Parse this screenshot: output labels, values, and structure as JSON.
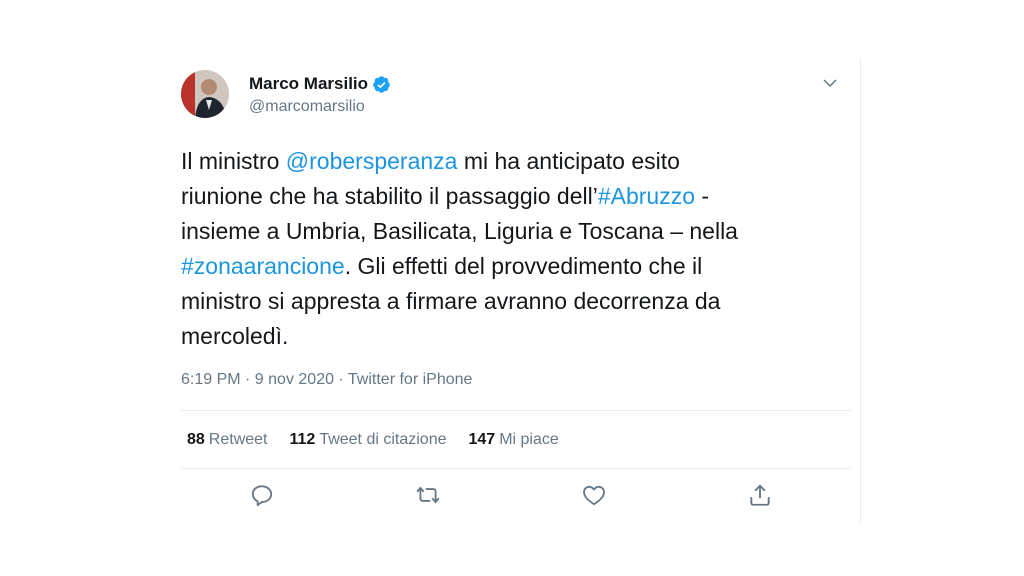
{
  "author": {
    "name": "Marco Marsilio",
    "handle": "@marcomarsilio",
    "verified_icon": "verified-badge-icon"
  },
  "tweet": {
    "lines": [
      [
        {
          "t": "Il ministro ",
          "link": false
        },
        {
          "t": "@robersperanza",
          "link": true
        },
        {
          "t": " mi ha anticipato esito",
          "link": false
        }
      ],
      [
        {
          "t": "riunione che ha stabilito il passaggio dell’",
          "link": false
        },
        {
          "t": "#Abruzzo",
          "link": true
        },
        {
          "t": " -",
          "link": false
        }
      ],
      [
        {
          "t": "insieme a Umbria, Basilicata, Liguria e Toscana – nella",
          "link": false
        }
      ],
      [
        {
          "t": "#zonaarancione",
          "link": true
        },
        {
          "t": ". Gli effetti del provvedimento che il",
          "link": false
        }
      ],
      [
        {
          "t": "ministro si appresta a firmare avranno decorrenza da",
          "link": false
        }
      ],
      [
        {
          "t": "mercoledì.",
          "link": false
        }
      ]
    ],
    "meta": "6:19 PM · 9 nov 2020 · Twitter for iPhone"
  },
  "stats": {
    "retweets": {
      "count": "88",
      "label": "Retweet"
    },
    "quotes": {
      "count": "112",
      "label": "Tweet di citazione"
    },
    "likes": {
      "count": "147",
      "label": "Mi piace"
    }
  },
  "colors": {
    "link": "#1b95e0",
    "verified": "#1da1f2",
    "muted": "#657786"
  },
  "actions": [
    "reply-icon",
    "retweet-icon",
    "like-icon",
    "share-icon"
  ]
}
